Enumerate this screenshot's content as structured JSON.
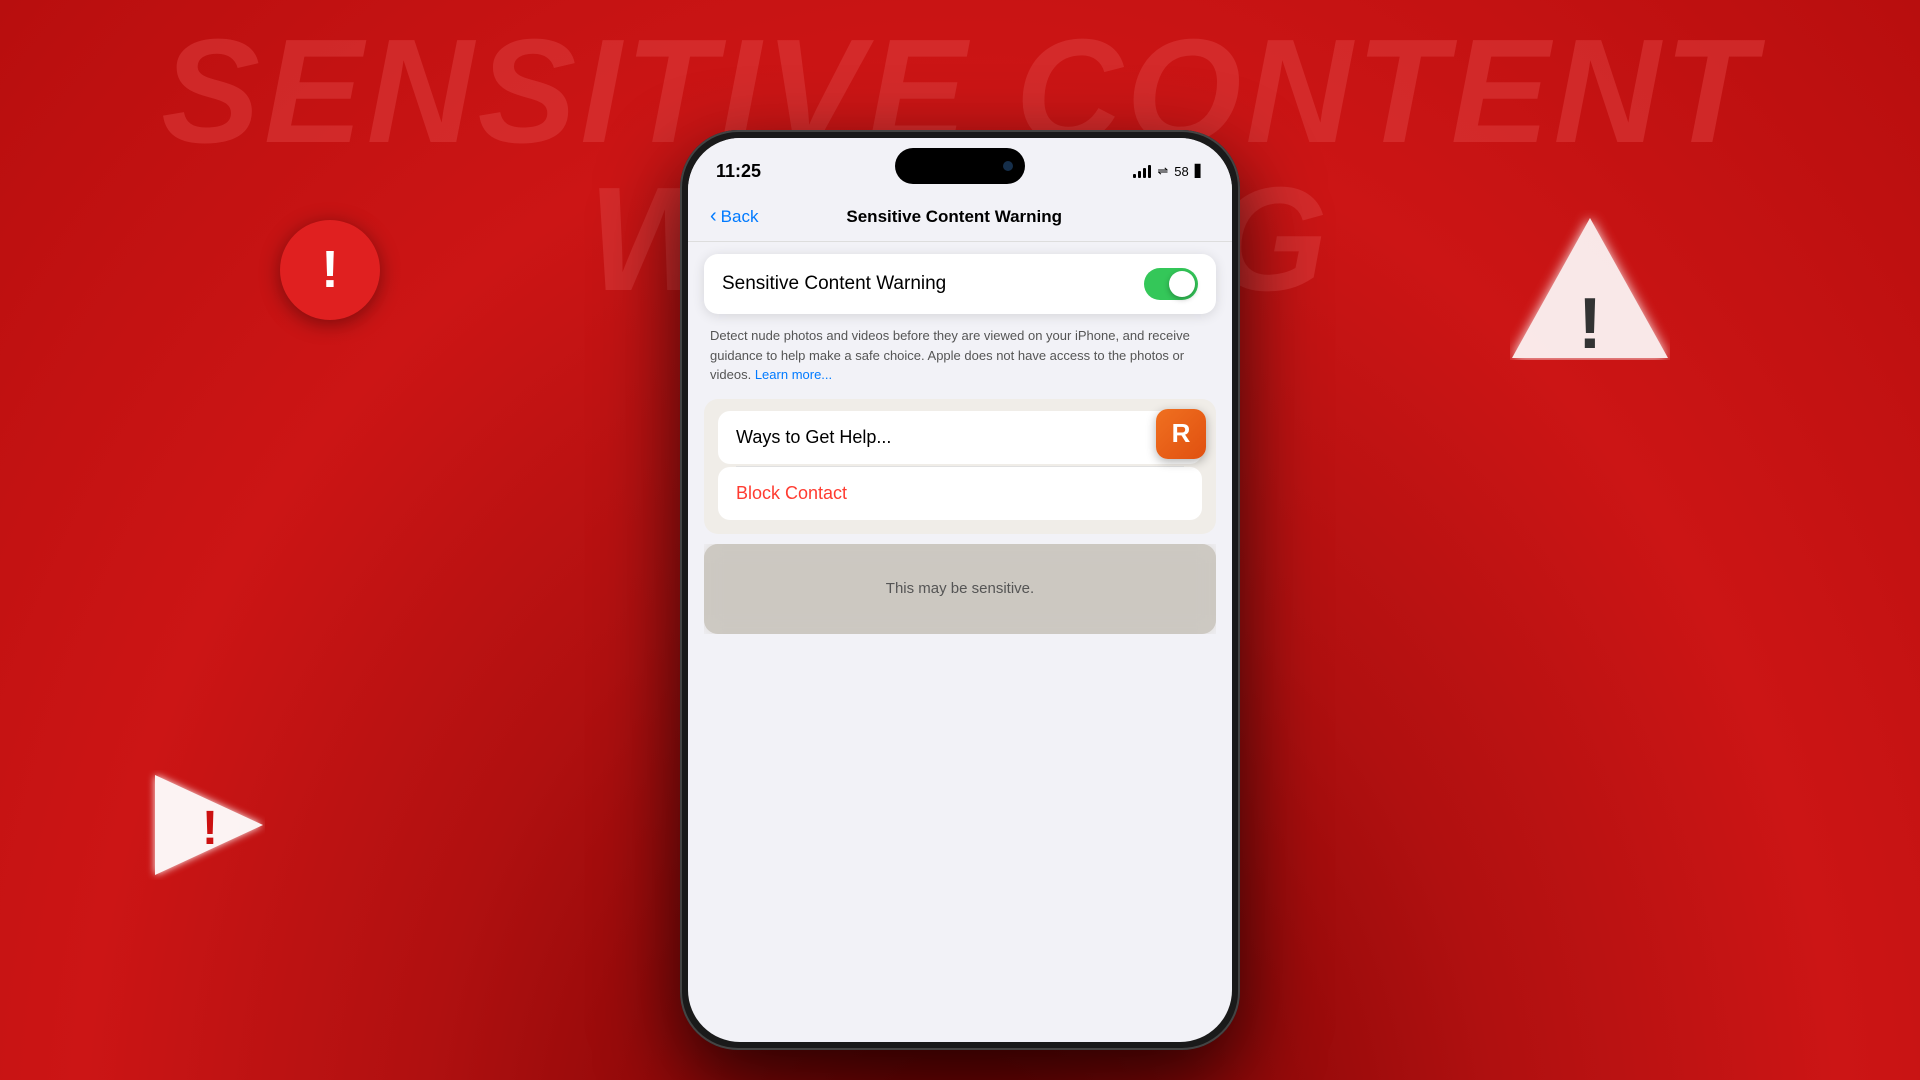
{
  "background": {
    "color": "#c01010"
  },
  "main_title": "SENSITIVE CONTENT WARNING",
  "phone": {
    "status_bar": {
      "time": "11:25",
      "battery": "58"
    },
    "nav": {
      "back_label": "Back",
      "title": "Sensitive Content Warning"
    },
    "toggle_section": {
      "label": "Sensitive Content Warning",
      "state": "on"
    },
    "description": "Detect nude photos and videos before they are viewed on your iPhone, and receive guidance to help make a safe choice. Apple does not have access to the photos or videos.",
    "learn_more": "Learn more...",
    "action_items": [
      {
        "label": "Ways to Get Help...",
        "color": "normal"
      },
      {
        "label": "Block Contact",
        "color": "red"
      }
    ],
    "sensitive_label": "This may be sensitive."
  },
  "icons": {
    "warning_circle": "!",
    "warning_triangle": "!",
    "play_warning": "!"
  }
}
